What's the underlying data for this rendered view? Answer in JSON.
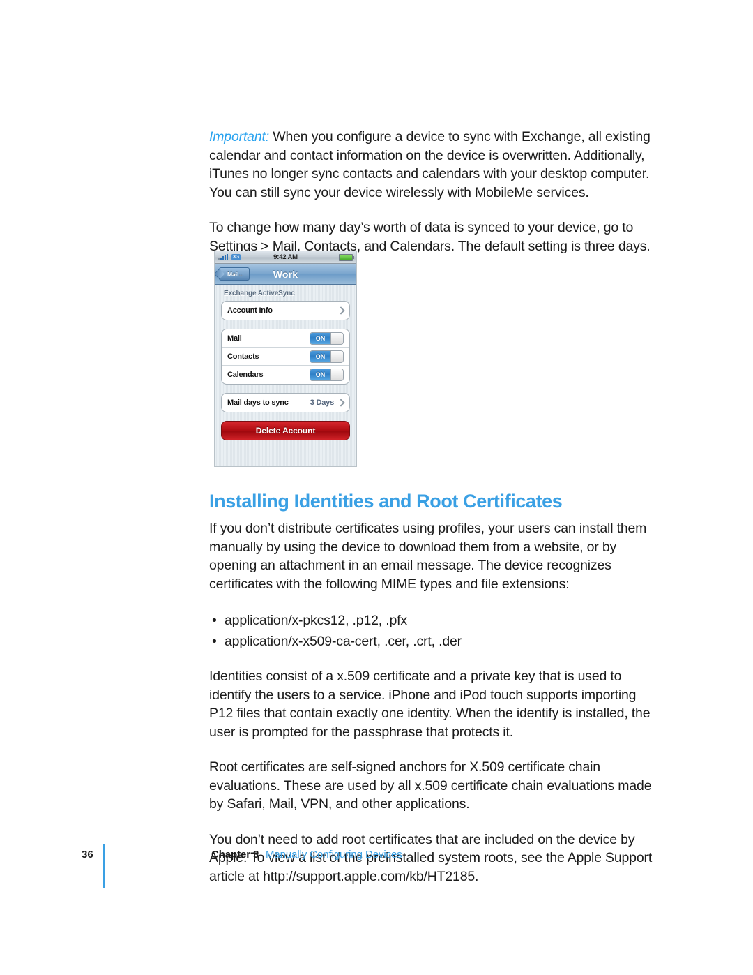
{
  "document": {
    "paragraphs": {
      "important_lead": "Important:",
      "important_body": " When you configure a device to sync with Exchange, all existing calendar and contact information on the device is overwritten. Additionally, iTunes no longer sync contacts and calendars with your desktop computer. You can still sync your device wirelessly with MobileMe services.",
      "p2": "To change how many day’s worth of data is synced to your device, go to Settings > Mail, Contacts, and Calendars. The default setting is three days.",
      "p3": "If you don’t distribute certificates using profiles, your users can install them manually by using the device to download them from a website, or by opening an attachment in an email message. The device recognizes certificates with the following MIME types and file extensions:",
      "p4": "Identities consist of a x.509 certificate and a private key that is used to identify the users to a service. iPhone and iPod touch supports importing P12 files that contain exactly one identity. When the identify is installed, the user is prompted for the passphrase that protects it.",
      "p5": "Root certificates are self-signed anchors for X.509 certificate chain evaluations. These are used by all x.509 certificate chain evaluations made by Safari, Mail, VPN, and other applications.",
      "p6": "You don’t need to add root certificates that are included on the device by Apple. To view a list of the preinstalled system roots, see the Apple Support article at http://support.apple.com/kb/HT2185."
    },
    "heading": "Installing Identities and Root Certificates",
    "bullets": [
      "application/x-pkcs12, .p12, .pfx",
      "application/x-x509-ca-cert, .cer, .crt, .der"
    ],
    "footer": {
      "page_number": "36",
      "chapter": "Chapter 3",
      "chapter_title": "Manually Configuring Devices"
    },
    "colors": {
      "accent_blue": "#3aa0e4",
      "important_blue": "#2aa3ef",
      "body_text": "#1b1b1b"
    }
  },
  "figure": {
    "status_bar": {
      "signal_icon": "signal-bars-icon",
      "network": "3G",
      "time": "9:42 AM",
      "battery_icon": "battery-icon"
    },
    "nav_bar": {
      "back_label": "Mail...",
      "title": "Work"
    },
    "group_header": "Exchange ActiveSync",
    "rows": [
      {
        "label": "Account Info",
        "type": "disclosure",
        "value": ""
      },
      {
        "label": "Mail",
        "type": "toggle",
        "value": "ON"
      },
      {
        "label": "Contacts",
        "type": "toggle",
        "value": "ON"
      },
      {
        "label": "Calendars",
        "type": "toggle",
        "value": "ON"
      },
      {
        "label": "Mail days to sync",
        "type": "value-disclosure",
        "value": "3 Days"
      }
    ],
    "delete_button": "Delete Account"
  }
}
